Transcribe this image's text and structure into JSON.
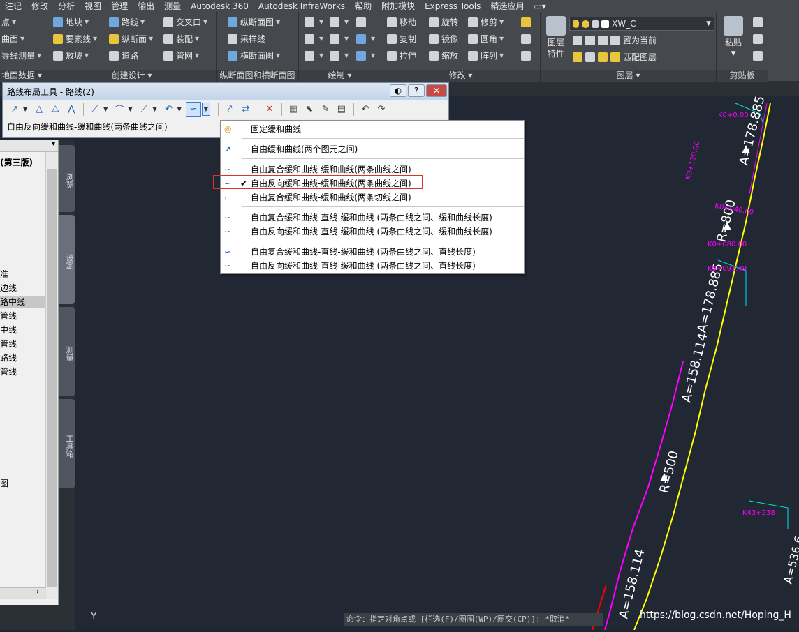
{
  "menubar": [
    "注记",
    "修改",
    "分析",
    "视图",
    "管理",
    "输出",
    "测量",
    "Autodesk 360",
    "Autodesk InfraWorks",
    "帮助",
    "附加模块",
    "Express Tools",
    "精选应用"
  ],
  "ribbon": {
    "left_items": [
      "点",
      "曲面",
      "导线测量",
      "地面数据"
    ],
    "create_design": {
      "items": [
        "地块",
        "要素线",
        "放坡",
        "路线",
        "纵断面",
        "道路",
        "交叉口",
        "装配",
        "管网"
      ],
      "title": "创建设计"
    },
    "profile_section": {
      "items": [
        "纵断面图",
        "采样线",
        "横断面图"
      ],
      "title": "纵断面图和横断面图"
    },
    "draw": {
      "title": "绘制"
    },
    "modify": {
      "items": [
        "移动",
        "旋转",
        "修剪",
        "复制",
        "镜像",
        "圆角",
        "拉伸",
        "缩放",
        "阵列"
      ],
      "title": "修改"
    },
    "layers": {
      "big_label_1": "图层",
      "big_label_2": "特性",
      "current_layer": "XW_C",
      "set_current": "置为当前",
      "match_layer": "匹配图层",
      "title": "图层"
    },
    "clipboard": {
      "paste": "粘贴",
      "title": "剪贴板"
    }
  },
  "toolwindow": {
    "title": "路线布局工具 - 路线(2)",
    "status": "自由反向缓和曲线-缓和曲线(两条曲线之间)"
  },
  "dropdown": {
    "items": [
      {
        "label": "固定缓和曲线",
        "checked": false
      },
      {
        "label": "自由缓和曲线(两个图元之间)",
        "checked": false
      },
      {
        "label": "自由复合缓和曲线-缓和曲线(两条曲线之间)",
        "checked": false
      },
      {
        "label": "自由反向缓和曲线-缓和曲线(两条曲线之间)",
        "checked": true
      },
      {
        "label": "自由复合缓和曲线-缓和曲线(两条切线之间)",
        "checked": false
      },
      {
        "label": "自由复合缓和曲线-直线-缓和曲线 (两条曲线之间、缓和曲线长度)",
        "checked": false
      },
      {
        "label": "自由反向缓和曲线-直线-缓和曲线 (两条曲线之间、缓和曲线长度)",
        "checked": false
      },
      {
        "label": "自由复合缓和曲线-直线-缓和曲线 (两条曲线之间、直线长度)",
        "checked": false
      },
      {
        "label": "自由反向缓和曲线-直线-缓和曲线 (两条曲线之间、直线长度)",
        "checked": false
      }
    ]
  },
  "palette": {
    "heading": "(第三版)",
    "items": [
      "准",
      "边线",
      "路中线",
      "管线",
      "中线",
      "管线",
      "路线",
      "管线",
      "图"
    ],
    "vtabs": [
      "浏览",
      "设定",
      "测量",
      "工具箱"
    ]
  },
  "canvas": {
    "labels": [
      "A=178.885",
      "R=800",
      "A=178.885",
      "A=158.114",
      "R=500",
      "A=158.114",
      "A=536.6",
      "K0+0.00",
      "K0+040.00",
      "K0+080.00",
      "K0+091.49",
      "K0+120.00",
      "K43+238"
    ],
    "ucs_label": "Y"
  },
  "command_line": "命令：指定对角点或 [栏选(F)/圈围(WP)/圈交(CP)]: *取消*",
  "watermark": "https://blog.csdn.net/Hoping_H",
  "colors": {
    "canvas": "#212733",
    "alignment_yellow": "#ffff00",
    "alignment_magenta": "#ff00ff",
    "cyan": "#00e5e5",
    "highlight": "#e0302a"
  }
}
